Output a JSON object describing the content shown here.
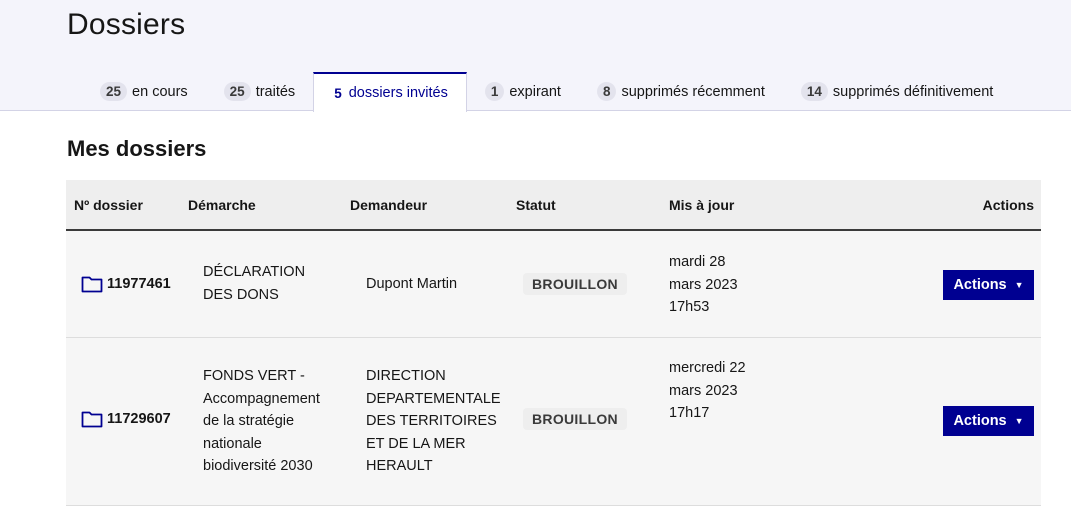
{
  "page": {
    "title": "Dossiers"
  },
  "tabs": [
    {
      "count": "25",
      "label": "en cours"
    },
    {
      "count": "25",
      "label": "traités"
    },
    {
      "count": "5",
      "label": "dossiers invités"
    },
    {
      "count": "1",
      "label": "expirant"
    },
    {
      "count": "8",
      "label": "supprimés récemment"
    },
    {
      "count": "14",
      "label": "supprimés définitivement"
    }
  ],
  "active_tab": "dossiers invités",
  "section": {
    "title": "Mes dossiers"
  },
  "table": {
    "headers": {
      "numero": "Nº dossier",
      "demarche": "Démarche",
      "demandeur": "Demandeur",
      "statut": "Statut",
      "maj": "Mis à jour",
      "actions": "Actions"
    },
    "rows": [
      {
        "numero": "11977461",
        "demarche": [
          "DÉCLARATION",
          "DES DONS"
        ],
        "demandeur": [
          "Dupont Martin"
        ],
        "statut": "BROUILLON",
        "maj": [
          "mardi 28",
          "mars 2023",
          "17h53"
        ],
        "action_label": "Actions"
      },
      {
        "numero": "11729607",
        "demarche": [
          "FONDS VERT -",
          "Accompagnement",
          "de la stratégie",
          "nationale",
          "biodiversité 2030"
        ],
        "demandeur": [
          "DIRECTION",
          "DEPARTEMENTALE",
          "DES TERRITOIRES",
          "ET DE LA MER",
          "HERAULT"
        ],
        "statut": "BROUILLON",
        "maj": [
          "mercredi 22",
          "mars 2023",
          "17h17"
        ],
        "action_label": "Actions"
      }
    ]
  },
  "icons": {
    "folder": "folder-icon",
    "caret": "caret-down-icon"
  },
  "colors": {
    "primary": "#000091",
    "band": "#f4f4fb",
    "table_bg": "#f6f6f6"
  }
}
